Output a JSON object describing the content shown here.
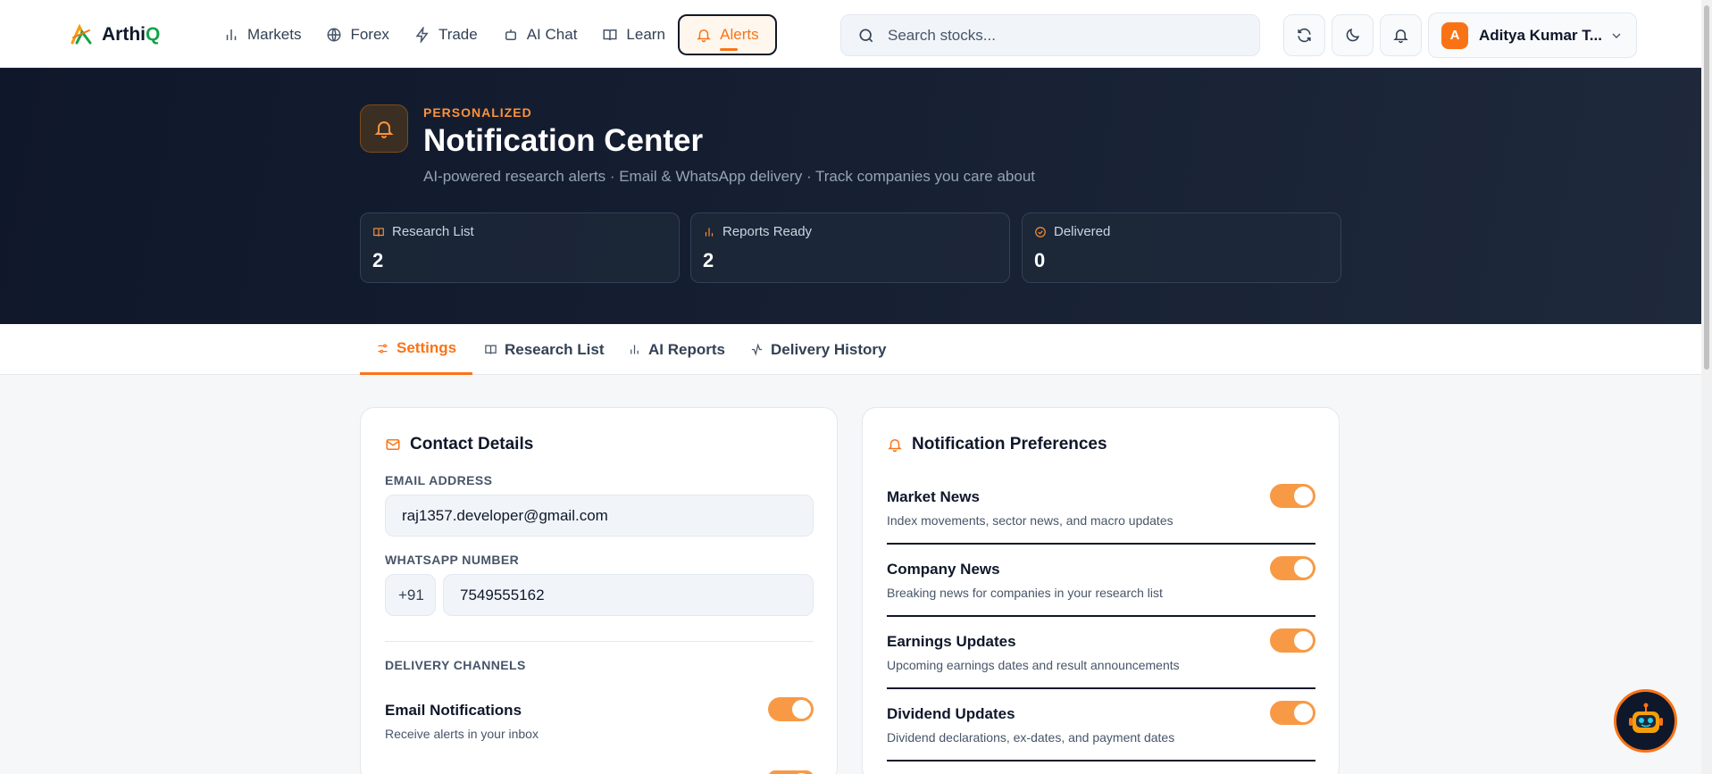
{
  "app": {
    "logo_text": "Arthi",
    "logo_text_accent": "Q"
  },
  "nav": {
    "items": [
      {
        "label": "Markets",
        "icon": "bar-chart-icon"
      },
      {
        "label": "Forex",
        "icon": "globe-icon"
      },
      {
        "label": "Trade",
        "icon": "lightning-icon"
      },
      {
        "label": "AI Chat",
        "icon": "robot-icon"
      },
      {
        "label": "Learn",
        "icon": "book-icon"
      },
      {
        "label": "Alerts",
        "icon": "bell-icon",
        "active": true
      }
    ]
  },
  "search": {
    "placeholder": "Search stocks..."
  },
  "user": {
    "initial": "A",
    "name": "Aditya Kumar T..."
  },
  "hero": {
    "eyebrow": "PERSONALIZED",
    "title": "Notification Center",
    "subtitle": "AI-powered research alerts · Email & WhatsApp delivery · Track companies you care about",
    "stats": [
      {
        "label": "Research List",
        "value": "2",
        "icon": "book-icon"
      },
      {
        "label": "Reports Ready",
        "value": "2",
        "icon": "bar-chart-icon"
      },
      {
        "label": "Delivered",
        "value": "0",
        "icon": "check-circle-icon"
      }
    ]
  },
  "tabs": [
    {
      "label": "Settings",
      "icon": "sliders-icon",
      "active": true
    },
    {
      "label": "Research List",
      "icon": "book-icon"
    },
    {
      "label": "AI Reports",
      "icon": "bar-chart-icon"
    },
    {
      "label": "Delivery History",
      "icon": "activity-icon"
    }
  ],
  "contact": {
    "title": "Contact Details",
    "email_label": "EMAIL ADDRESS",
    "email_value": "raj1357.developer@gmail.com",
    "whatsapp_label": "WHATSAPP NUMBER",
    "country_code": "+91",
    "whatsapp_value": "7549555162",
    "channels_label": "DELIVERY CHANNELS",
    "email_notif_title": "Email Notifications",
    "email_notif_desc": "Receive alerts in your inbox",
    "email_notif_enabled": true
  },
  "preferences": {
    "title": "Notification Preferences",
    "items": [
      {
        "title": "Market News",
        "desc": "Index movements, sector news, and macro updates",
        "enabled": true
      },
      {
        "title": "Company News",
        "desc": "Breaking news for companies in your research list",
        "enabled": true
      },
      {
        "title": "Earnings Updates",
        "desc": "Upcoming earnings dates and result announcements",
        "enabled": true
      },
      {
        "title": "Dividend Updates",
        "desc": "Dividend declarations, ex-dates, and payment dates",
        "enabled": true
      }
    ]
  },
  "colors": {
    "accent": "#f97316",
    "hero_bg": "#0f172a",
    "brand_green": "#16a34a"
  }
}
